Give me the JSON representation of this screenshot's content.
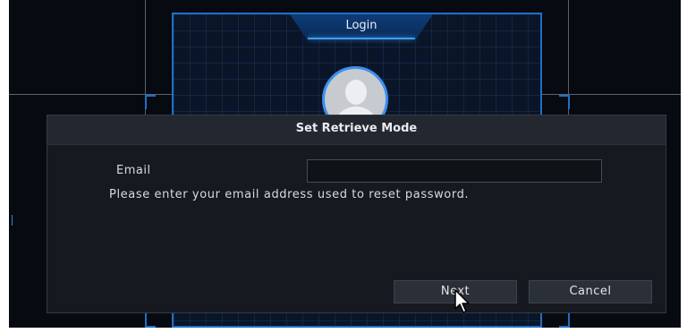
{
  "login": {
    "title": "Login"
  },
  "dialog": {
    "title": "Set Retrieve Mode",
    "email_label": "Email",
    "email_value": "",
    "email_placeholder": "",
    "hint": "Please enter your email address used to reset password.",
    "next_label": "Next",
    "cancel_label": "Cancel"
  },
  "icons": {
    "avatar": "user-avatar-icon",
    "cursor": "mouse-pointer-icon"
  },
  "colors": {
    "accent": "#1f6fc9",
    "dialog_bg": "#161a20",
    "header_bg": "#232830",
    "button_bg": "#2b3038"
  }
}
